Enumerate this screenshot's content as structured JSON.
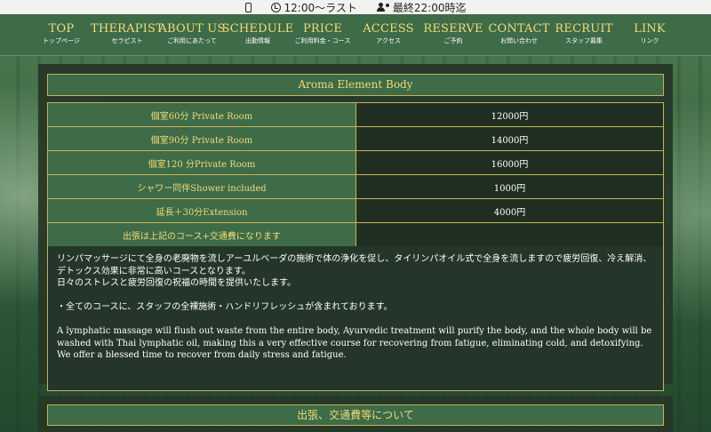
{
  "topbar": {
    "hours": "12:00〜ラスト",
    "last_entry": "最終22:00時迄"
  },
  "nav": [
    {
      "en": "TOP",
      "jp": "トップページ"
    },
    {
      "en": "THERAPIST",
      "jp": "セラピスト"
    },
    {
      "en": "ABOUT US",
      "jp": "ご利用にあたって"
    },
    {
      "en": "SCHEDULE",
      "jp": "出勤情報"
    },
    {
      "en": "PRICE",
      "jp": "ご利用料金・コース"
    },
    {
      "en": "ACCESS",
      "jp": "アクセス"
    },
    {
      "en": "RESERVE",
      "jp": "ご予約"
    },
    {
      "en": "CONTACT",
      "jp": "お問い合わせ"
    },
    {
      "en": "RECRUIT",
      "jp": "スタッフ募集"
    },
    {
      "en": "LINK",
      "jp": "リンク"
    }
  ],
  "section_title": "Aroma Element Body",
  "prices": [
    {
      "course": "個室60分 Private Room",
      "price": "12000円"
    },
    {
      "course": "個室90分 Private Room",
      "price": "14000円"
    },
    {
      "course": "個室120 分Private Room",
      "price": "16000円"
    },
    {
      "course": "シャワー同伴Shower included",
      "price": "1000円"
    },
    {
      "course": "延長＋30分Extension",
      "price": "4000円"
    },
    {
      "course": "出張は上記のコース+交通費になります",
      "price": ""
    }
  ],
  "description": {
    "jp_line1": "リンパマッサージにて全身の老廃物を流しアーユルベーダの施術で体の浄化を促し、タイリンパオイル式で全身を流しますので疲労回復、冷え解消、デトックス効果に非常に高いコースとなります。",
    "jp_line2": "日々のストレスと疲労回復の祝福の時間を提供いたします。",
    "jp_line3": "・全てのコースに、スタッフの全裸施術・ハンドリフレッシュが含まれております。",
    "en_line1": "A lymphatic massage will flush out waste from the entire body, Ayurvedic treatment will purify the body, and the whole body will be washed with Thai lymphatic oil, making this a very effective course for recovering from fatigue, eliminating cold, and detoxifying.",
    "en_line2": "We offer a blessed time to recover from daily stress and fatigue."
  },
  "next_section_title": "出張、交通費等について",
  "colors": {
    "accent_gold": "#f0dc78",
    "border_gold": "#c6b25d",
    "green": "#3e6b48",
    "dark": "#1f2e21"
  },
  "icons": {
    "phone": "phone-icon",
    "clock": "clock-icon",
    "users": "users-icon"
  }
}
